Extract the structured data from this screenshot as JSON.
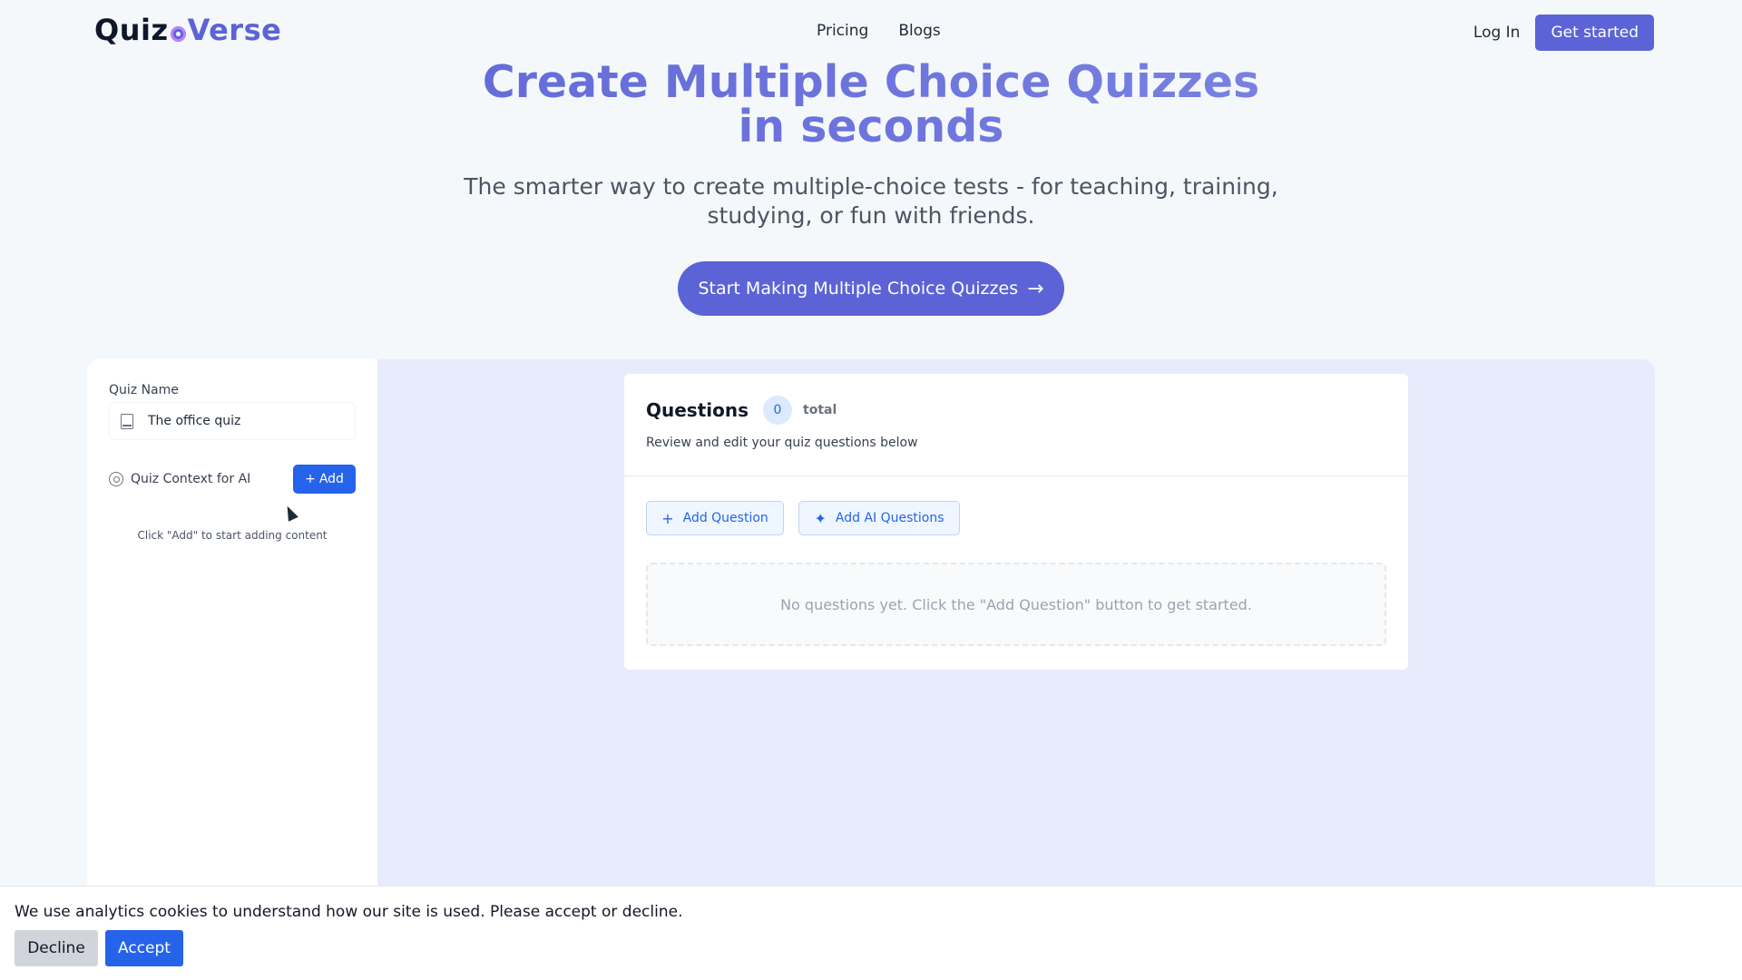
{
  "brand": {
    "part1": "Quiz",
    "part2": "Verse"
  },
  "nav": {
    "links": [
      "Pricing",
      "Blogs"
    ],
    "login": "Log In",
    "get_started": "Get started"
  },
  "hero": {
    "title_line1": "Create Multiple Choice Quizzes",
    "title_line2": "in seconds",
    "subtitle": "The smarter way to create multiple-choice tests - for teaching, training, studying, or fun with friends.",
    "cta": "Start Making Multiple Choice Quizzes",
    "cta_arrow": "→"
  },
  "sidebar": {
    "quiz_name_label": "Quiz Name",
    "quiz_name_value": "The office quiz",
    "context_label": "Quiz Context for AI",
    "add_label": "Add",
    "add_icon": "+",
    "hint": "Click \"Add\" to start adding content"
  },
  "questions": {
    "title": "Questions",
    "count": "0",
    "total_label": "total",
    "subtitle": "Review and edit your quiz questions below",
    "add_question": "Add Question",
    "add_ai_questions": "Add AI Questions",
    "empty_text": "No questions yet. Click the \"Add Question\" button to get started."
  },
  "cookie": {
    "text": "We use analytics cookies to understand how our site is used. Please accept or decline.",
    "decline": "Decline",
    "accept": "Accept"
  },
  "colors": {
    "brand": "#5b63d6",
    "primary": "#2563eb",
    "panel": "#e8ebfb"
  }
}
